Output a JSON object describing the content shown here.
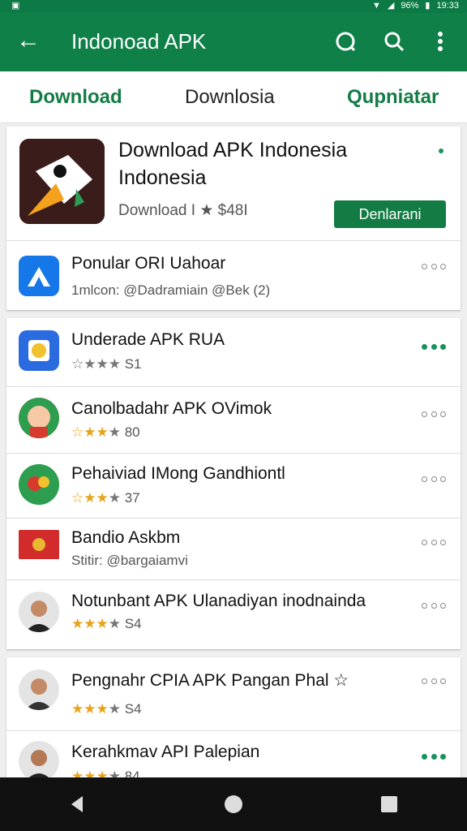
{
  "status_bar": {
    "time": "19:33",
    "battery": "96%"
  },
  "app_bar": {
    "title": "Indonoad APK"
  },
  "tabs": [
    {
      "label": "Download"
    },
    {
      "label": "Downlosia"
    },
    {
      "label": "Qupniatar"
    }
  ],
  "featured": {
    "title": "Download APK Indonesia Indonesia",
    "meta": "Download I ★ $48I",
    "button": "Denlarani"
  },
  "rows": [
    {
      "name": "Ponular ORI Uahoar",
      "meta": "1mlcon: @Dadramiain @Bek (2)"
    },
    {
      "name": "Underade APK RUA",
      "meta": "S1"
    },
    {
      "name": "Canolbadahr APK OVimok",
      "meta": "80"
    },
    {
      "name": "Pehaiviad IMong Gandhiontl",
      "meta": "37"
    },
    {
      "name": "Bandio Askbm",
      "meta": "Stitir: @bargaiamvi"
    },
    {
      "name": "Notunbant APK Ulanadiyan inodnainda",
      "meta": "S4"
    },
    {
      "name": "Pengnahr CPIA APK Pangan Phal ☆",
      "meta": "S4"
    },
    {
      "name": "Kerahkmav API Palepian",
      "meta": "84"
    }
  ],
  "colors": {
    "primary": "#0f8048",
    "accent": "#137c45",
    "star": "#e8a317"
  }
}
